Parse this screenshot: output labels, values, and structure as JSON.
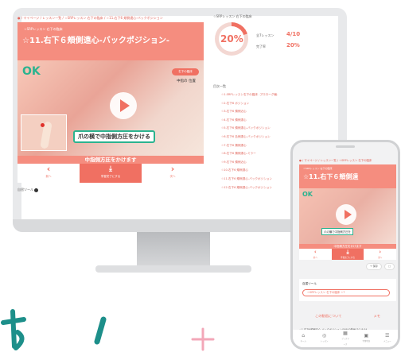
{
  "desktop": {
    "breadcrumb": "● / マイページ / レッスン一覧 / ☆SRPレッスン 右下の臨床 / ☆11.右下6 頬側遠心-バックポジション",
    "lesson_subtitle": "☆SRPレッスン 右下の臨床",
    "lesson_title": "☆11.右下６頬側遠心-バックポジション-",
    "ok_mark": "OK",
    "badge": "右下の臨床",
    "badge_note": "中指の 位置",
    "video_caption": "爪の横で中指側方圧をかける",
    "control_caption": "中指側方圧をかけます",
    "nav_prev_label": "前へ",
    "nav_mid_label": "学習完了にする",
    "nav_next_label": "次へ",
    "tool_label": "自習ツール",
    "progress_head": "☆SRPレッスン 右下の臨床",
    "progress_percent": "20%",
    "stat1_label": "全7レッスン",
    "stat1_value": "4/10",
    "stat2_label": "完了率",
    "stat2_value": "20%",
    "list_head": "目次一覧",
    "lessons": [
      {
        "label": "☆1.SRPレッスン右下の臨床 -プロローグ編-",
        "state": "plain"
      },
      {
        "label": "☆2.右下6 ポジション",
        "state": "plain"
      },
      {
        "label": "☆3.右下6 頬側近心",
        "state": "plain"
      },
      {
        "label": "☆4.右下6 頬側遠心",
        "state": "plain"
      },
      {
        "label": "☆5.右下6 頬側遠心-バックポジション",
        "state": "plain"
      },
      {
        "label": "☆6.右下6 舌側遠心-バックポジション",
        "state": "plain"
      },
      {
        "label": "☆7.右下6 頬側遠心",
        "state": "plain"
      },
      {
        "label": "☆8.右下6 頬側遠心-ミラー",
        "state": "plain"
      },
      {
        "label": "☆9.右下6 頬側近心",
        "state": "done"
      },
      {
        "label": "☆10.右下6 頬側遠心",
        "state": "plain"
      },
      {
        "label": "☆11.右下6 頬側遠心-バックポジション",
        "state": "cur"
      },
      {
        "label": "☆12.右下6 頬側遠心-バックポジション",
        "state": "done"
      }
    ]
  },
  "phone": {
    "breadcrumb": "● / マイページ / レッスン一覧 / ☆SRPレッスン 右下の臨床",
    "lesson_subtitle": "☆SRPレッスン 右下の臨床",
    "lesson_title": "☆11.右下６頬側遠",
    "ok_mark": "OK",
    "video_caption": "爪の横で中指側方圧を",
    "control_caption": "中指側方圧をかけます",
    "nav_prev_label": "前へ",
    "nav_mid_label": "学習完了にする",
    "nav_next_label": "次へ",
    "btn_save": "+ 保存",
    "btn_note": "□",
    "tool_label": "自習ツール",
    "tool_chip": "☆SRPレッスン 右下の臨床 ☆7",
    "tab_about": "この動画について",
    "tab_memo": "メモ",
    "footer_text": "☆1.右下6頬側遠心-バックポジション(5分)の動画(7/1 8:54",
    "tabbar": [
      "ホーム",
      "レッスン",
      "ブックマーク",
      "学習状況",
      "メニュー"
    ]
  }
}
